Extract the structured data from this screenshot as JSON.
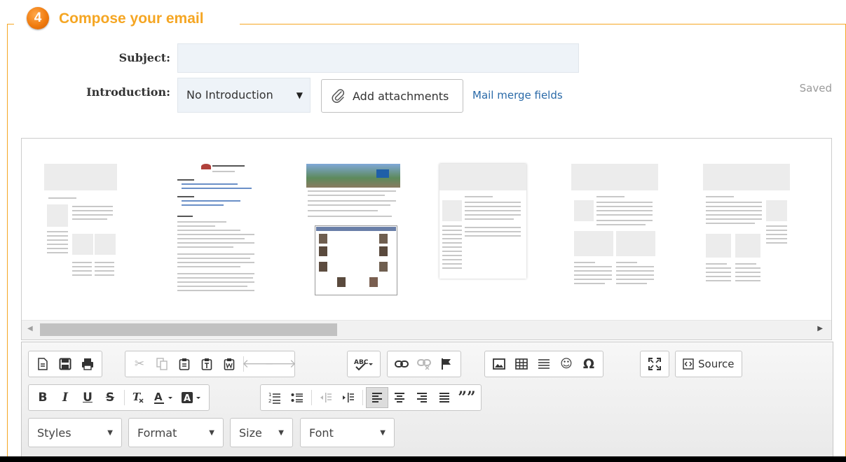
{
  "section": {
    "step_number": "4",
    "title": "Compose your email"
  },
  "form": {
    "subject_label": "Subject:",
    "subject_value": "",
    "introduction_label": "Introduction:",
    "introduction_selected": "No Introduction",
    "attach_label": "Add attachments",
    "mail_merge_label": "Mail merge fields",
    "status": "Saved"
  },
  "toolbar": {
    "source_label": "Source",
    "bold_label": "B",
    "italic_label": "I",
    "underline_label": "U",
    "strike_label": "S",
    "omega_label": "Ω",
    "quote_label": "””",
    "combos": [
      "Styles",
      "Format",
      "Size",
      "Font"
    ]
  },
  "colors": {
    "accent": "#f5a623",
    "link": "#2a6aa8"
  }
}
